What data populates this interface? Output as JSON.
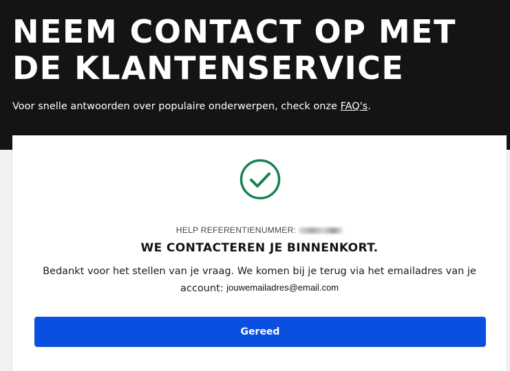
{
  "header": {
    "title": "NEEM CONTACT OP MET DE KLANTENSERVICE",
    "subtitle_prefix": "Voor snelle antwoorden over populaire onderwerpen, check onze ",
    "faq_link": "FAQ's",
    "subtitle_suffix": "."
  },
  "confirmation": {
    "icon": "check-circle-icon",
    "reference_label": "HELP REFERENTIENUMMER:",
    "heading": "WE CONTACTEREN JE BINNENKORT.",
    "message": "Bedankt voor het stellen van je vraag. We komen bij je terug via het emailadres van je account:",
    "email": "jouwemailadres@email.com",
    "done_button": "Gereed"
  },
  "colors": {
    "hero_background": "#141414",
    "success_green": "#15834f",
    "button_blue": "#0a4fe0"
  }
}
